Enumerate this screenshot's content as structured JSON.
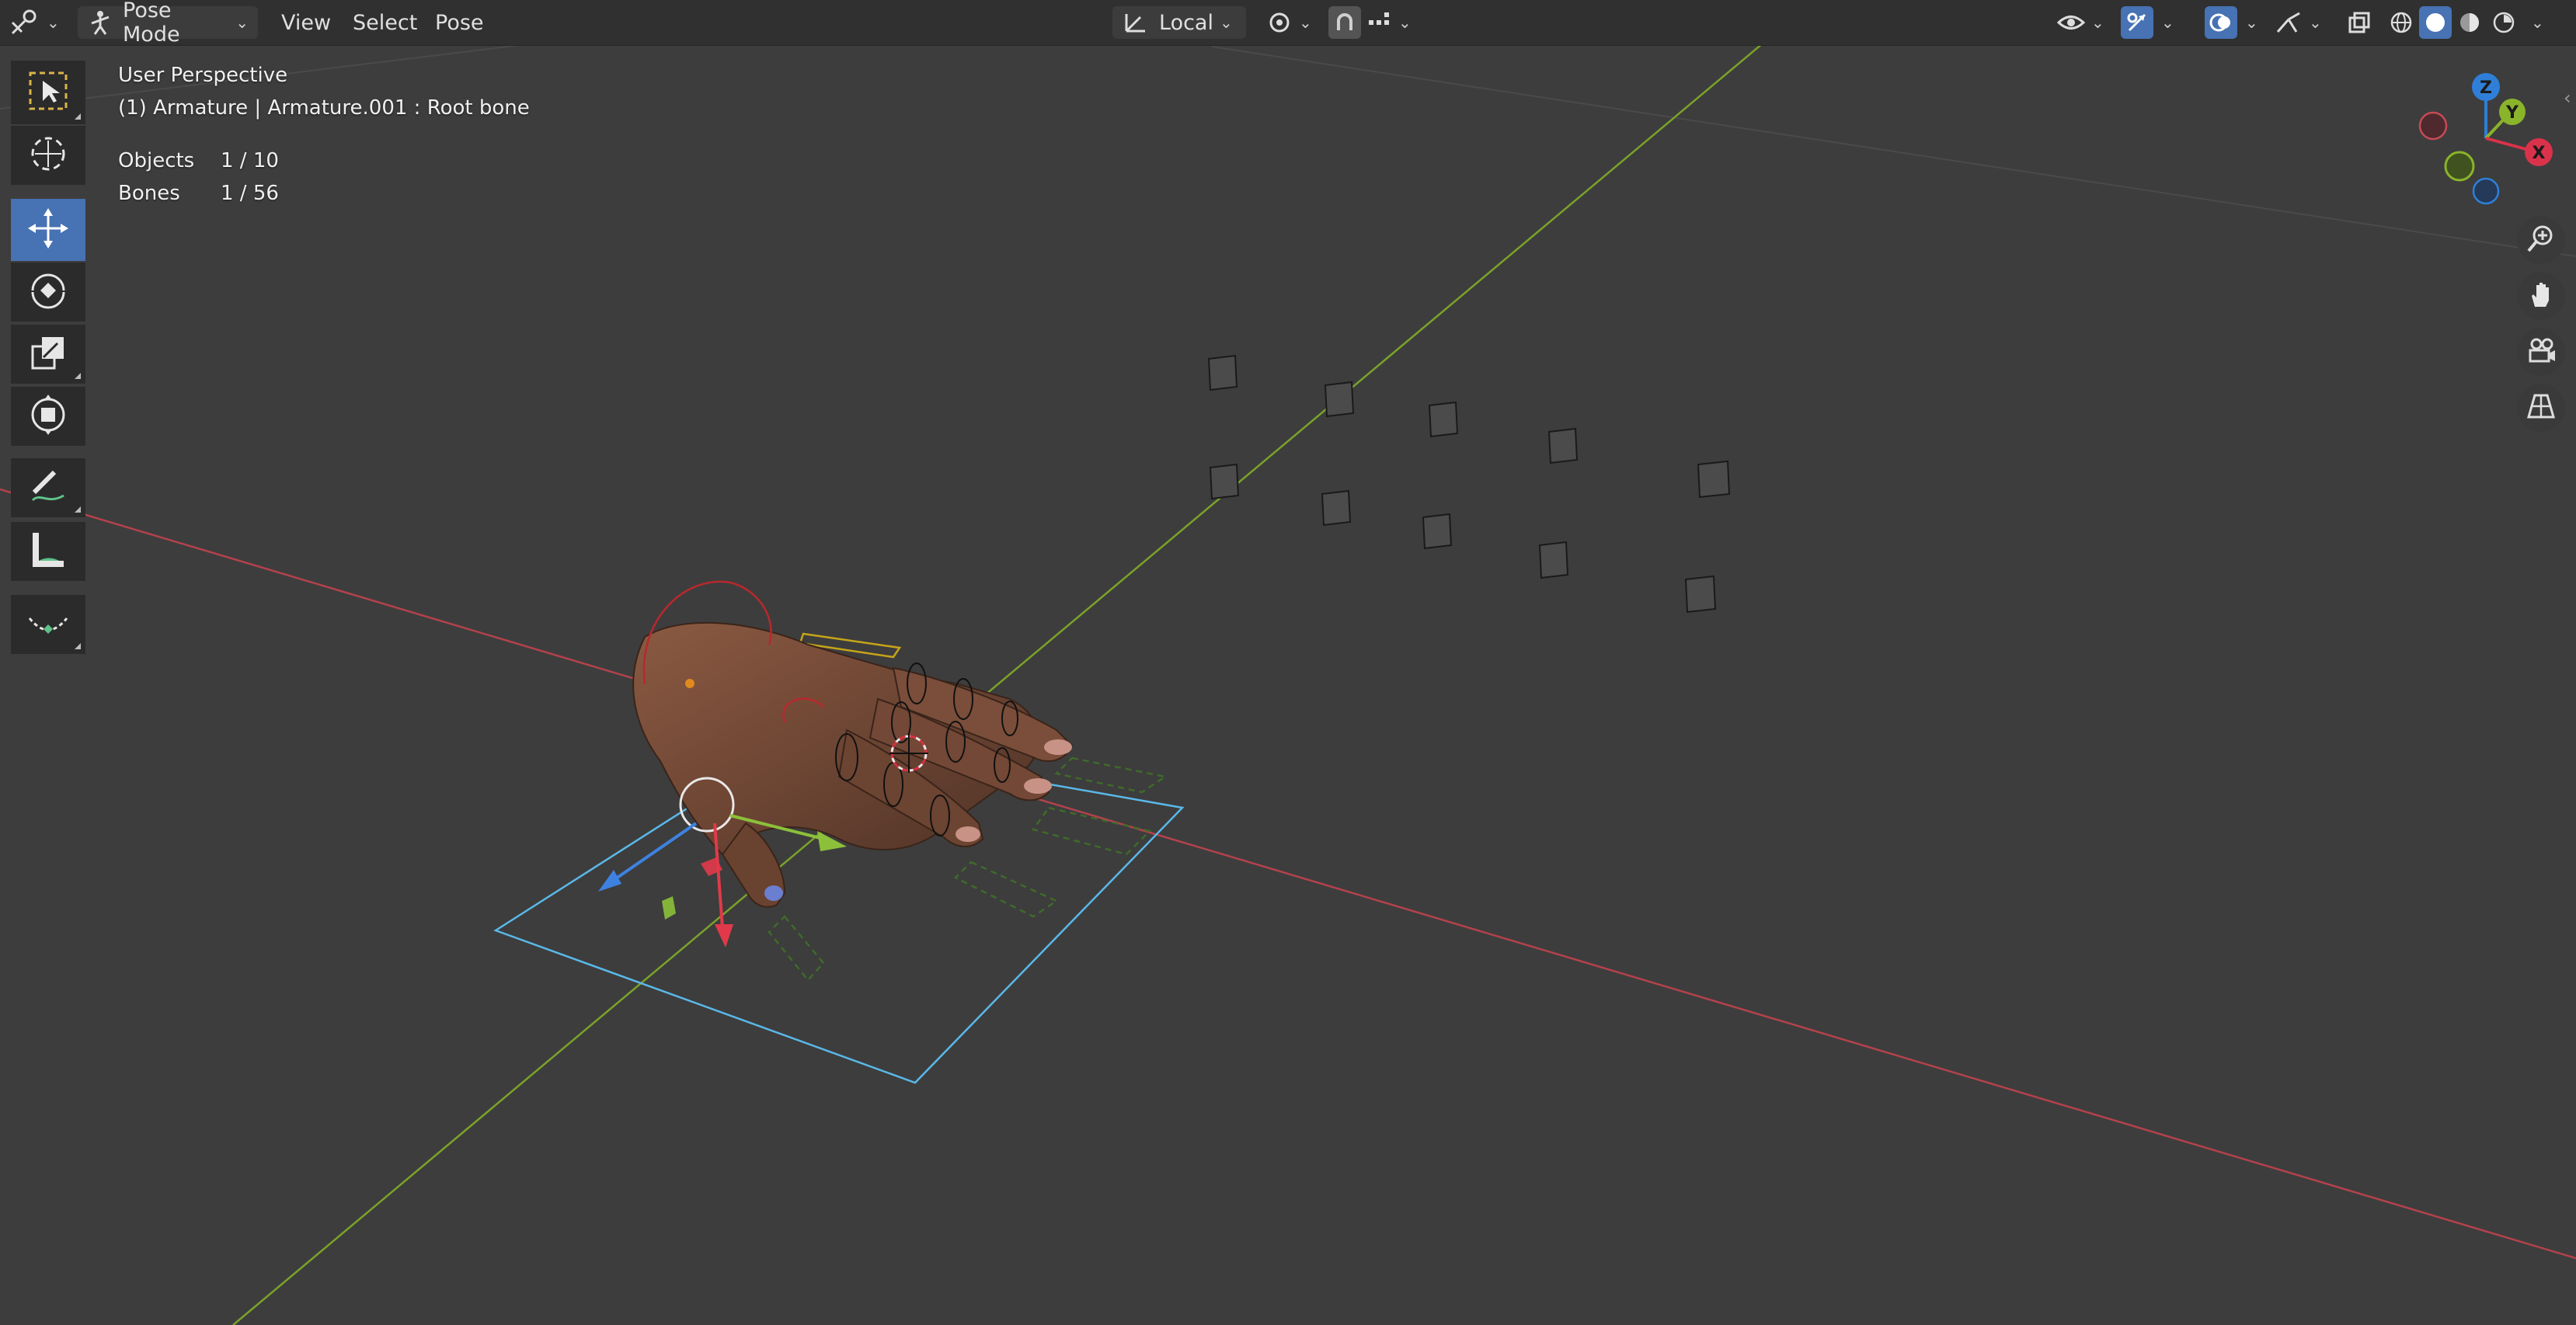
{
  "header": {
    "mode_label": "Pose Mode",
    "menus": [
      "View",
      "Select",
      "Pose"
    ],
    "orientation_label": "Local",
    "icons": {
      "editor_type": "armature-editor-icon",
      "pivot": "pivot-point-icon",
      "snap": "snap-magnet-icon",
      "snap_target": "snap-increment-icon",
      "visibility": "eye-visibility-icon",
      "gizmo": "gizmo-toggle-icon",
      "overlays": "overlays-icon",
      "xray": "xray-toggle-icon",
      "shading_wire": "wireframe-shading-icon",
      "shading_solid": "solid-shading-icon",
      "shading_material": "material-shading-icon",
      "shading_render": "rendered-shading-icon"
    }
  },
  "overlay": {
    "view_name": "User Perspective",
    "selection_info": "(1) Armature | Armature.001 : Root bone",
    "objects_label": "Objects",
    "objects_value": "1 / 10",
    "bones_label": "Bones",
    "bones_value": "1 / 56"
  },
  "toolbar": {
    "tools": [
      "select-box-tool-icon",
      "cursor-tool-icon",
      "move-tool-icon",
      "rotate-tool-icon",
      "scale-tool-icon",
      "transform-tool-icon",
      "annotate-tool-icon",
      "measure-tool-icon",
      "relax-pose-tool-icon"
    ],
    "active_index": 2
  },
  "gizmo_labels": {
    "x": "X",
    "y": "Y",
    "z": "Z"
  },
  "colors": {
    "background": "#3d3d3d",
    "header": "#303030",
    "accent": "#4772b3",
    "axis_x": "#c84a55",
    "axis_y": "#8ab42a",
    "axis_z": "#2f7fd8",
    "selection_outline": "#5ab8e8"
  }
}
